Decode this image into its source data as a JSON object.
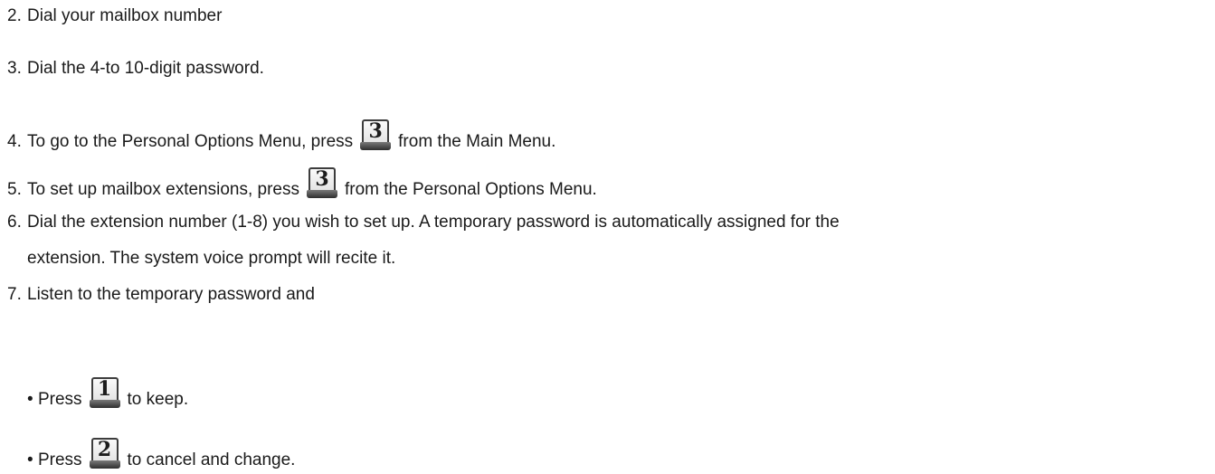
{
  "steps": [
    {
      "number": "2.",
      "text": "Dial your mailbox number"
    },
    {
      "number": "3.",
      "text": "Dial the 4-to 10-digit password."
    },
    {
      "number": "4.",
      "text_before": "To go to the Personal Options Menu, press",
      "key": "3",
      "text_after": "from the Main Menu."
    },
    {
      "number": "5.",
      "text_before": "To set up mailbox extensions, press",
      "key": "3",
      "text_after": "from the Personal Options Menu."
    },
    {
      "number": "6.",
      "text": "Dial the extension number (1-8) you wish to set up. A temporary password is automatically assigned for the",
      "text_continued": "extension. The system voice prompt will recite it."
    },
    {
      "number": "7.",
      "text": "Listen to the temporary password and"
    }
  ],
  "sub_items": [
    {
      "bullet": "•",
      "text_before": "Press",
      "key": "1",
      "text_after": "to keep."
    },
    {
      "bullet": "•",
      "text_before": "Press",
      "key": "2",
      "text_after": "to cancel and change."
    }
  ],
  "icons": {
    "key_icon": "keypad-key-icon"
  }
}
